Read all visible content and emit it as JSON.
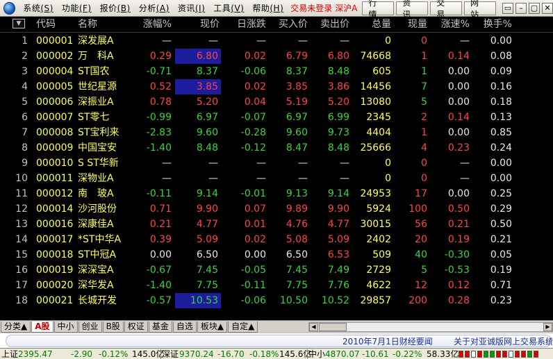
{
  "menu": {
    "items": [
      {
        "label": "系统",
        "key": "(S)"
      },
      {
        "label": "功能",
        "key": "(F)"
      },
      {
        "label": "报价",
        "key": "(B)"
      },
      {
        "label": "分析",
        "key": "(A)"
      },
      {
        "label": "资讯",
        "key": "(I)"
      },
      {
        "label": "工具",
        "key": "(V)"
      },
      {
        "label": "帮助",
        "key": "(H)"
      }
    ],
    "trade_status": "交易未登录",
    "market": "深沪A",
    "nav_buttons": [
      "行情",
      "资讯",
      "交易",
      "网站"
    ],
    "window_controls": [
      "▭",
      "–",
      "▢",
      "✕"
    ]
  },
  "table": {
    "sort_button": "▼",
    "headers": [
      "代码",
      "名称",
      "涨幅%",
      "现价",
      "日涨跌",
      "买入价",
      "卖出价",
      "总量",
      "现量",
      "涨速%",
      "换手%"
    ],
    "rows": [
      {
        "idx": "1",
        "code": "000001",
        "name": "深发展A",
        "chg": "—",
        "price": "—",
        "dchg": "—",
        "bid": "—",
        "ask": "—",
        "vol": "0",
        "cur": "0",
        "spd": "—",
        "turn": "0.00",
        "dir": "flat",
        "hl": false
      },
      {
        "idx": "2",
        "code": "000002",
        "name": "万　科A",
        "chg": "0.29",
        "price": "6.80",
        "dchg": "0.02",
        "bid": "6.79",
        "ask": "6.80",
        "vol": "74668",
        "cur": "1",
        "spd": "0.14",
        "turn": "0.08",
        "dir": "up",
        "hl": true
      },
      {
        "idx": "3",
        "code": "000004",
        "name": "ST国农",
        "chg": "-0.71",
        "price": "8.37",
        "dchg": "-0.06",
        "bid": "8.37",
        "ask": "8.48",
        "vol": "605",
        "cur": "1",
        "spd": "0.00",
        "turn": "0.09",
        "dir": "down",
        "hl": false
      },
      {
        "idx": "4",
        "code": "000005",
        "name": "世纪星源",
        "chg": "0.52",
        "price": "3.85",
        "dchg": "0.02",
        "bid": "3.85",
        "ask": "3.86",
        "vol": "14456",
        "cur": "7",
        "spd": "0.00",
        "turn": "0.16",
        "dir": "up",
        "hl": true
      },
      {
        "idx": "5",
        "code": "000006",
        "name": "深振业A",
        "chg": "0.78",
        "price": "5.20",
        "dchg": "0.04",
        "bid": "5.19",
        "ask": "5.20",
        "vol": "13080",
        "cur": "5",
        "spd": "0.00",
        "turn": "0.18",
        "dir": "up",
        "hl": false
      },
      {
        "idx": "6",
        "code": "000007",
        "name": "ST零七",
        "chg": "-0.99",
        "price": "6.97",
        "dchg": "-0.07",
        "bid": "6.97",
        "ask": "6.99",
        "vol": "2345",
        "cur": "2",
        "spd": "0.14",
        "turn": "0.13",
        "dir": "down",
        "hl": false
      },
      {
        "idx": "7",
        "code": "000008",
        "name": "ST宝利来",
        "chg": "-2.83",
        "price": "9.60",
        "dchg": "-0.28",
        "bid": "9.60",
        "ask": "9.73",
        "vol": "4404",
        "cur": "1",
        "spd": "0.00",
        "turn": "0.85",
        "dir": "down",
        "hl": false
      },
      {
        "idx": "8",
        "code": "000009",
        "name": "中国宝安",
        "chg": "-1.40",
        "price": "8.48",
        "dchg": "-0.12",
        "bid": "8.47",
        "ask": "8.48",
        "vol": "25666",
        "cur": "4",
        "spd": "0.23",
        "turn": "0.24",
        "dir": "down",
        "hl": false
      },
      {
        "idx": "9",
        "code": "000010",
        "name": "S ST华新",
        "chg": "—",
        "price": "—",
        "dchg": "—",
        "bid": "—",
        "ask": "—",
        "vol": "0",
        "cur": "0",
        "spd": "—",
        "turn": "0.00",
        "dir": "flat",
        "hl": false
      },
      {
        "idx": "10",
        "code": "000011",
        "name": "深物业A",
        "chg": "—",
        "price": "—",
        "dchg": "—",
        "bid": "—",
        "ask": "—",
        "vol": "0",
        "cur": "0",
        "spd": "—",
        "turn": "0.00",
        "dir": "flat",
        "hl": false
      },
      {
        "idx": "11",
        "code": "000012",
        "name": "南　玻A",
        "chg": "-0.11",
        "price": "9.14",
        "dchg": "-0.01",
        "bid": "9.13",
        "ask": "9.14",
        "vol": "24953",
        "cur": "17",
        "spd": "0.00",
        "turn": "0.25",
        "dir": "down",
        "hl": false
      },
      {
        "idx": "12",
        "code": "000014",
        "name": "沙河股份",
        "chg": "0.71",
        "price": "9.90",
        "dchg": "0.07",
        "bid": "9.89",
        "ask": "9.90",
        "vol": "5924",
        "cur": "100",
        "spd": "0.50",
        "turn": "0.29",
        "dir": "up",
        "hl": false
      },
      {
        "idx": "13",
        "code": "000016",
        "name": "深康佳A",
        "chg": "0.21",
        "price": "4.77",
        "dchg": "0.01",
        "bid": "4.76",
        "ask": "4.77",
        "vol": "30015",
        "cur": "56",
        "spd": "0.21",
        "turn": "0.50",
        "dir": "up",
        "hl": false
      },
      {
        "idx": "14",
        "code": "000017",
        "name": "*ST中华A",
        "chg": "0.39",
        "price": "5.09",
        "dchg": "0.02",
        "bid": "5.08",
        "ask": "5.09",
        "vol": "2402",
        "cur": "20",
        "spd": "0.19",
        "turn": "0.21",
        "dir": "up",
        "hl": false
      },
      {
        "idx": "15",
        "code": "000018",
        "name": "ST中冠A",
        "chg": "0.00",
        "price": "6.50",
        "dchg": "0.00",
        "bid": "6.50",
        "ask": "6.53",
        "vol": "509",
        "cur": "40",
        "spd": "-0.30",
        "turn": "0.05",
        "dir": "flat",
        "hl": false
      },
      {
        "idx": "16",
        "code": "000019",
        "name": "深深宝A",
        "chg": "-0.67",
        "price": "7.45",
        "dchg": "-0.05",
        "bid": "7.45",
        "ask": "7.49",
        "vol": "2729",
        "cur": "5",
        "spd": "-0.53",
        "turn": "0.19",
        "dir": "down",
        "hl": false
      },
      {
        "idx": "17",
        "code": "000020",
        "name": "深华发A",
        "chg": "-1.40",
        "price": "7.75",
        "dchg": "-0.11",
        "bid": "7.75",
        "ask": "7.76",
        "vol": "4622",
        "cur": "12",
        "spd": "0.12",
        "turn": "0.71",
        "dir": "down",
        "hl": false
      },
      {
        "idx": "18",
        "code": "000021",
        "name": "长城开发",
        "chg": "-0.57",
        "price": "10.53",
        "dchg": "-0.06",
        "bid": "10.50",
        "ask": "10.52",
        "vol": "29857",
        "cur": "200",
        "spd": "0.28",
        "turn": "0.23",
        "dir": "down",
        "hl": true
      }
    ]
  },
  "tabs": [
    "分类▲",
    "A股",
    "中小",
    "创业",
    "B股",
    "权证",
    "基金",
    "自选",
    "板块▲",
    "自定▲"
  ],
  "active_tab": 1,
  "news": {
    "item1": "2010年7月1日财经要闻",
    "item2": "关于对亚诚版网上交易系统"
  },
  "ticker": {
    "sh_label": "上证",
    "sh_value": "2395.47",
    "sh_change": "-2.90",
    "sh_pct": "-0.12%",
    "sh_amount": "145.0亿",
    "sz_label": "深证",
    "sz_value": "9370.24",
    "sz_change": "-16.70",
    "sz_pct": "-0.18%",
    "sz_amount": "145.6亿",
    "zx_label": "中小",
    "zx_value": "4870.07",
    "zx_change": "-10.61",
    "zx_pct": "-0.22%",
    "zx_amount": "58.33亿"
  }
}
